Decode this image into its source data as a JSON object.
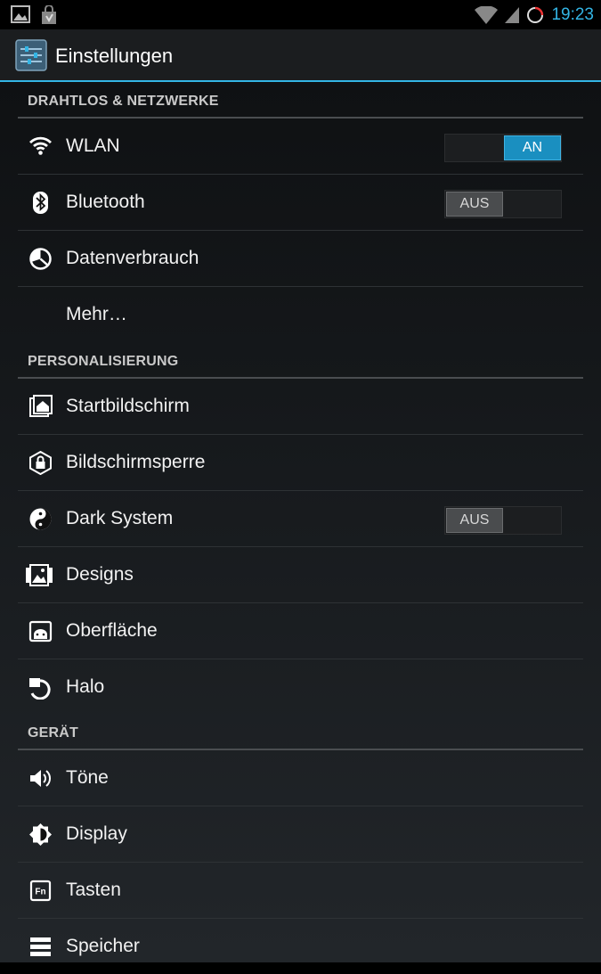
{
  "status_bar": {
    "time": "19:23",
    "icons": [
      "gallery-icon",
      "store-icon",
      "wifi-signal-icon",
      "cell-signal-icon",
      "loading-circle-icon"
    ]
  },
  "action_bar": {
    "title": "Einstellungen",
    "icon": "settings-app-icon"
  },
  "sections": [
    {
      "header": "DRAHTLOS & NETZWERKE",
      "items": [
        {
          "label": "WLAN",
          "icon": "wifi-icon",
          "toggle": "AN",
          "toggle_state": "on"
        },
        {
          "label": "Bluetooth",
          "icon": "bluetooth-icon",
          "toggle": "AUS",
          "toggle_state": "off"
        },
        {
          "label": "Datenverbrauch",
          "icon": "data-usage-icon"
        },
        {
          "label": "Mehr…"
        }
      ]
    },
    {
      "header": "PERSONALISIERUNG",
      "items": [
        {
          "label": "Startbildschirm",
          "icon": "home-screen-icon"
        },
        {
          "label": "Bildschirmsperre",
          "icon": "lock-screen-icon"
        },
        {
          "label": "Dark System",
          "icon": "yin-yang-icon",
          "toggle": "AUS",
          "toggle_state": "off"
        },
        {
          "label": "Designs",
          "icon": "themes-icon"
        },
        {
          "label": "Oberfläche",
          "icon": "interface-icon"
        },
        {
          "label": "Halo",
          "icon": "halo-icon"
        }
      ]
    },
    {
      "header": "GERÄT",
      "items": [
        {
          "label": "Töne",
          "icon": "speaker-icon"
        },
        {
          "label": "Display",
          "icon": "display-brightness-icon"
        },
        {
          "label": "Tasten",
          "icon": "fn-key-icon"
        },
        {
          "label": "Speicher",
          "icon": "storage-icon"
        }
      ]
    }
  ],
  "colors": {
    "accent": "#33b5e5",
    "toggle_on": "#1a8fc0",
    "toggle_off": "#4a4c4e"
  }
}
